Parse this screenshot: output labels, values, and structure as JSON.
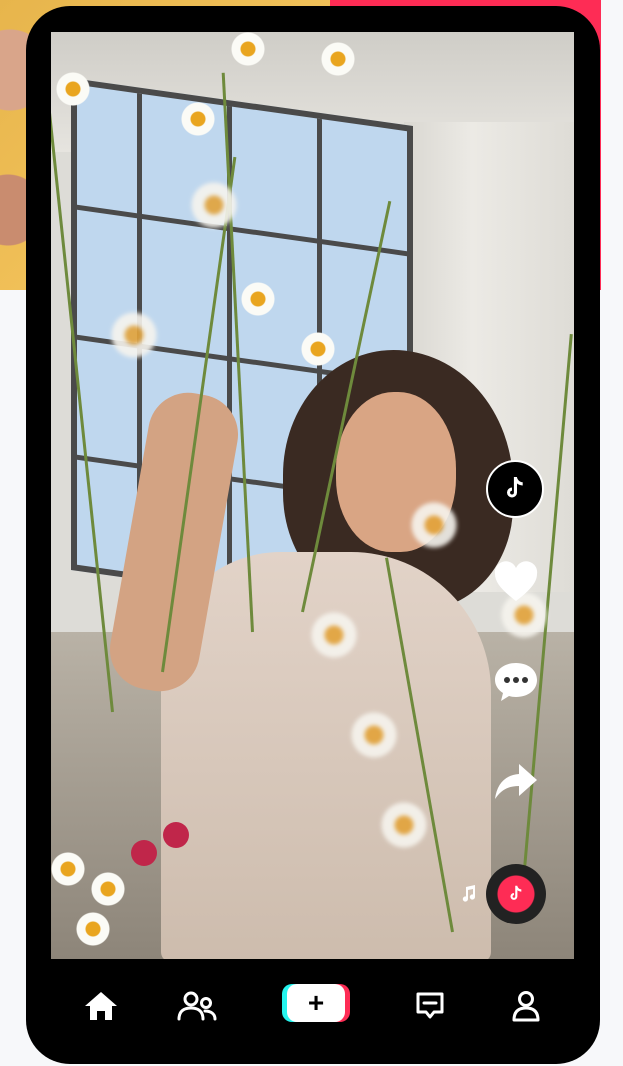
{
  "app": "TikTok",
  "feed": {
    "actions": [
      {
        "id": "profile",
        "icon": "tiktok-logo-icon"
      },
      {
        "id": "like",
        "icon": "heart-icon"
      },
      {
        "id": "comment",
        "icon": "comment-icon"
      },
      {
        "id": "share",
        "icon": "share-icon"
      }
    ],
    "sound": {
      "icon": "music-note-icon",
      "disc_icon": "tiktok-logo-icon"
    }
  },
  "bottom_nav": {
    "items": [
      {
        "id": "home",
        "icon": "home-icon",
        "active": true
      },
      {
        "id": "friends",
        "icon": "friends-icon"
      },
      {
        "id": "create",
        "label": "+",
        "icon": "plus-icon"
      },
      {
        "id": "inbox",
        "icon": "inbox-icon"
      },
      {
        "id": "profile",
        "icon": "profile-icon"
      }
    ]
  },
  "colors": {
    "brand_red": "#fe2c55",
    "brand_cyan": "#25f4ee",
    "phone_frame": "#000000",
    "page_background": "#f7f8fa"
  }
}
